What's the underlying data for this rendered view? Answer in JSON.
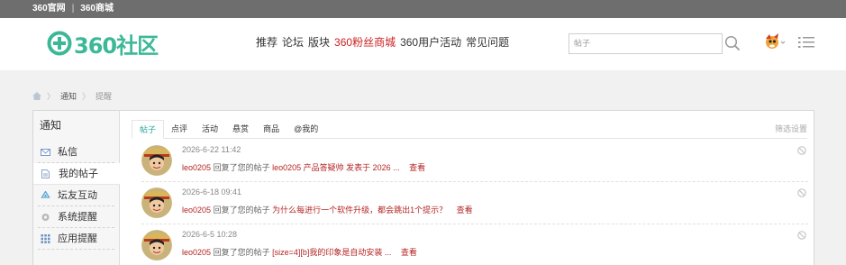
{
  "topbar": {
    "link1": "360官网",
    "sep": "|",
    "link2": "360商城"
  },
  "logo": {
    "text": "360社区",
    "icon": "plus-circle-icon",
    "color": "#3cb898"
  },
  "nav": [
    "推荐",
    "论坛",
    "版块",
    "360粉丝商城",
    "360用户活动",
    "常见问题"
  ],
  "nav_highlight_color": "#cc1f1f",
  "search": {
    "placeholder": "帖子",
    "icon": "search-icon"
  },
  "user": {
    "icon": "user-avatar-icon",
    "menu_icon": "list-menu-icon"
  },
  "breadcrumb": {
    "home_icon": "home-icon",
    "level1": "通知",
    "level2": "提醒",
    "sep": "〉"
  },
  "sidebar": {
    "title": "通知",
    "items": [
      {
        "label": "私信",
        "icon": "mail-icon"
      },
      {
        "label": "我的帖子",
        "icon": "document-icon",
        "active": true
      },
      {
        "label": "坛友互动",
        "icon": "recycle-icon"
      },
      {
        "label": "系统提醒",
        "icon": "gear-icon"
      },
      {
        "label": "应用提醒",
        "icon": "grid-icon"
      }
    ]
  },
  "tabs": [
    "帖子",
    "点评",
    "活动",
    "悬赏",
    "商品",
    "@我的"
  ],
  "filter_label": "筛选设置",
  "messages": [
    {
      "time": "2026-6-22 11:42",
      "user": "leo0205",
      "action": "回复了您的帖子",
      "post": "leo0205 产品答疑帅 发表于 2026 ...",
      "view": "查看"
    },
    {
      "time": "2026-6-18 09:41",
      "user": "leo0205",
      "action": "回复了您的帖子",
      "post": "为什么每进行一个软件升级，都会跳出1个提示？",
      "view": "查看"
    },
    {
      "time": "2026-6-5 10:28",
      "user": "leo0205",
      "action": "回复了您的帖子",
      "post": "[size=4][b]我的印象是自动安装 ...",
      "view": "查看"
    }
  ]
}
